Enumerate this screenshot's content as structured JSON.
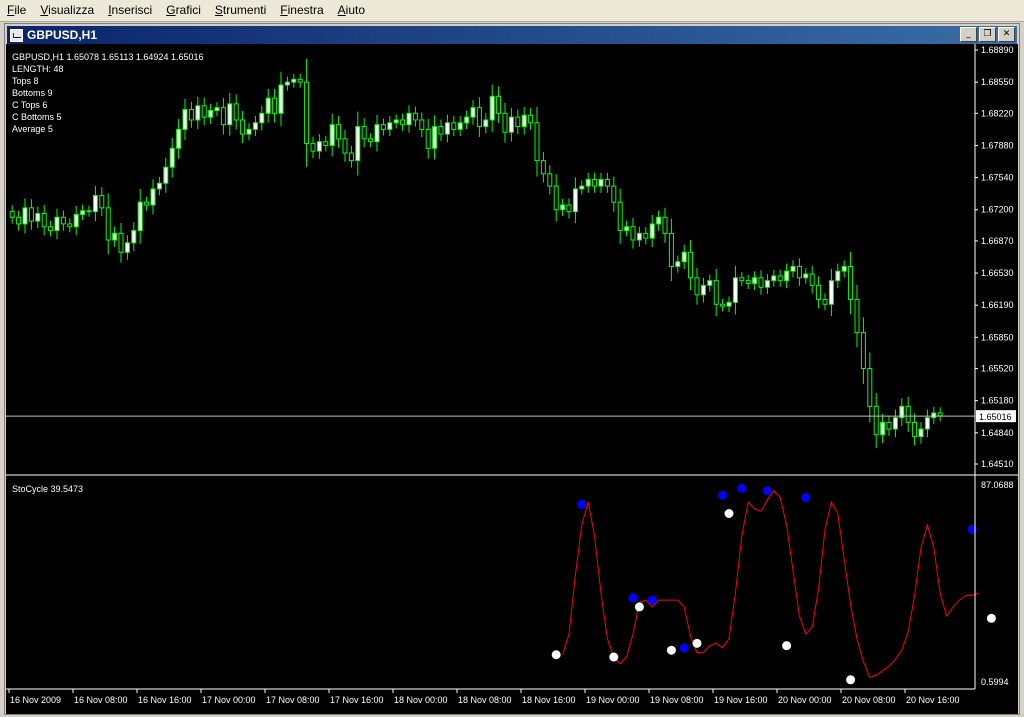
{
  "menu": [
    "File",
    "Visualizza",
    "Inserisci",
    "Grafici",
    "Strumenti",
    "Finestra",
    "Aiuto"
  ],
  "window": {
    "title": "GBPUSD,H1",
    "buttons": [
      "minimize",
      "restore",
      "close"
    ]
  },
  "price_panel": {
    "header": "GBPUSD,H1  1.65078 1.65113 1.64924 1.65016",
    "info_lines": [
      "LENGTH: 48",
      "Tops 8",
      "Bottoms 9",
      "C Tops 6",
      "C Bottoms 5",
      "Average 5"
    ],
    "y_ticks": [
      "1.68890",
      "1.68550",
      "1.68220",
      "1.67880",
      "1.67540",
      "1.67200",
      "1.66870",
      "1.66530",
      "1.66190",
      "1.65850",
      "1.65520",
      "1.65180",
      "1.64840",
      "1.64510"
    ],
    "current_price": "1.65016"
  },
  "indicator_panel": {
    "header": "StoCycle 39.5473",
    "y_ticks": [
      "87.0688",
      "0.5994"
    ]
  },
  "x_ticks": [
    "16 Nov 2009",
    "16 Nov 08:00",
    "16 Nov 16:00",
    "17 Nov 00:00",
    "17 Nov 08:00",
    "17 Nov 16:00",
    "18 Nov 00:00",
    "18 Nov 08:00",
    "18 Nov 16:00",
    "19 Nov 00:00",
    "19 Nov 08:00",
    "19 Nov 16:00",
    "20 Nov 00:00",
    "20 Nov 08:00",
    "20 Nov 16:00"
  ],
  "colors": {
    "background": "#000000",
    "bull_candle": "#ffffff",
    "bear_candle": "#000000",
    "wick": "#00ff00",
    "indicator_line": "#ff0000",
    "top_marker": "#0000ff",
    "bottom_marker": "#ffffff",
    "axis": "#ffffff"
  },
  "chart_data": [
    {
      "type": "candlestick",
      "title": "GBPUSD,H1",
      "ylim": [
        1.6451,
        1.6889
      ],
      "close": [
        1.6712,
        1.6705,
        1.6722,
        1.6708,
        1.6716,
        1.6702,
        1.6698,
        1.6712,
        1.6705,
        1.6702,
        1.6715,
        1.6719,
        1.6718,
        1.6735,
        1.6722,
        1.6688,
        1.6695,
        1.6675,
        1.6685,
        1.6698,
        1.6728,
        1.6725,
        1.6742,
        1.6748,
        1.6765,
        1.6785,
        1.6805,
        1.6826,
        1.6815,
        1.683,
        1.6818,
        1.6825,
        1.6828,
        1.681,
        1.6832,
        1.6815,
        1.68,
        1.6805,
        1.6812,
        1.6822,
        1.6838,
        1.6822,
        1.6852,
        1.6855,
        1.6858,
        1.6855,
        1.679,
        1.6782,
        1.6792,
        1.6788,
        1.681,
        1.6795,
        1.678,
        1.6772,
        1.6808,
        1.6795,
        1.6792,
        1.681,
        1.6805,
        1.6812,
        1.6815,
        1.681,
        1.6822,
        1.6815,
        1.6805,
        1.6785,
        1.6808,
        1.68,
        1.6812,
        1.6805,
        1.6812,
        1.6818,
        1.6828,
        1.6808,
        1.6815,
        1.684,
        1.6822,
        1.6802,
        1.6818,
        1.6808,
        1.682,
        1.6812,
        1.6772,
        1.6758,
        1.6745,
        1.672,
        1.6725,
        1.6718,
        1.6742,
        1.6745,
        1.6752,
        1.6745,
        1.6752,
        1.6745,
        1.6728,
        1.6698,
        1.6702,
        1.6688,
        1.6695,
        1.669,
        1.6705,
        1.6712,
        1.6695,
        1.666,
        1.6665,
        1.6675,
        1.6648,
        1.663,
        1.664,
        1.6645,
        1.662,
        1.6618,
        1.6622,
        1.6648,
        1.6645,
        1.6642,
        1.6648,
        1.6638,
        1.6645,
        1.665,
        1.6645,
        1.6655,
        1.666,
        1.6648,
        1.6652,
        1.664,
        1.6625,
        1.662,
        1.6645,
        1.6655,
        1.666,
        1.6625,
        1.659,
        1.6552,
        1.6512,
        1.6482,
        1.6495,
        1.6488,
        1.65,
        1.6512,
        1.6495,
        1.648,
        1.6488,
        1.65,
        1.6505,
        1.6502
      ]
    },
    {
      "type": "line",
      "title": "StoCycle 39.5473",
      "ylim": [
        0.5994,
        87.0688
      ],
      "x_index": [
        86,
        87,
        88,
        89,
        90,
        91,
        92,
        93,
        94,
        95,
        96,
        97,
        98,
        99,
        100,
        101,
        102,
        103,
        104,
        105,
        106,
        107,
        108,
        109,
        110,
        111,
        112,
        113,
        114,
        115,
        116,
        117,
        118,
        119,
        120,
        121,
        122,
        123,
        124,
        125,
        126,
        127,
        128,
        129,
        130,
        131,
        132,
        133,
        134,
        135,
        136,
        137,
        138,
        139,
        140,
        141,
        142,
        143,
        144,
        145,
        146,
        147,
        148,
        149,
        150,
        151,
        152,
        153
      ],
      "values": [
        13,
        22,
        48,
        70,
        80,
        65,
        40,
        20,
        12,
        9,
        12,
        22,
        36,
        37,
        34,
        37,
        37,
        37,
        37,
        34,
        21,
        14,
        14,
        17,
        18,
        16,
        20,
        40,
        65,
        80,
        77,
        76,
        81,
        85,
        82,
        70,
        50,
        30,
        22,
        25,
        42,
        68,
        80,
        75,
        55,
        35,
        20,
        10,
        3,
        4,
        6,
        8,
        11,
        15,
        23,
        39,
        60,
        70,
        60,
        40,
        30,
        34,
        37,
        39,
        39,
        40
      ],
      "tops_x": [
        89,
        97,
        100,
        105,
        111,
        114,
        118,
        124,
        150
      ],
      "tops_y": [
        79,
        38,
        37,
        16,
        83,
        86,
        85,
        82,
        68
      ],
      "bottoms_x": [
        85,
        94,
        98,
        103,
        107,
        112,
        121,
        131,
        153
      ],
      "bottoms_y": [
        13,
        12,
        34,
        15,
        18,
        75,
        17,
        2,
        29
      ]
    }
  ]
}
